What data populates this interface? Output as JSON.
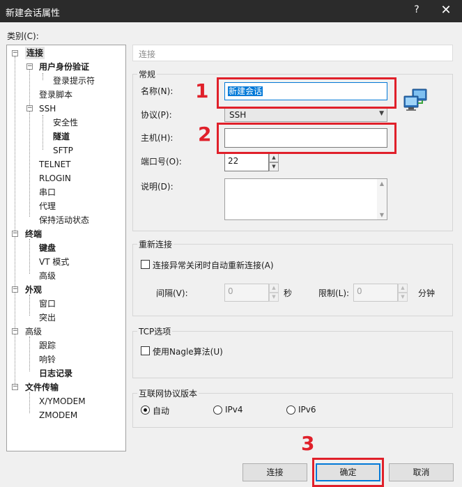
{
  "window": {
    "title": "新建会话属性",
    "help_glyph": "?",
    "close_glyph": "✕"
  },
  "category_label": "类别(C):",
  "tree": [
    {
      "label": "连接",
      "bold": true,
      "selected": true
    },
    {
      "label": "用户身份验证",
      "bold": true
    },
    {
      "label": "登录提示符"
    },
    {
      "label": "登录脚本"
    },
    {
      "label": "SSH"
    },
    {
      "label": "安全性"
    },
    {
      "label": "隧道",
      "bold": true
    },
    {
      "label": "SFTP"
    },
    {
      "label": "TELNET"
    },
    {
      "label": "RLOGIN"
    },
    {
      "label": "串口"
    },
    {
      "label": "代理"
    },
    {
      "label": "保持活动状态"
    },
    {
      "label": "终端",
      "bold": true
    },
    {
      "label": "键盘",
      "bold": true
    },
    {
      "label": "VT 模式"
    },
    {
      "label": "高级"
    },
    {
      "label": "外观",
      "bold": true
    },
    {
      "label": "窗口"
    },
    {
      "label": "突出"
    },
    {
      "label": "高级"
    },
    {
      "label": "跟踪"
    },
    {
      "label": "响铃"
    },
    {
      "label": "日志记录",
      "bold": true
    },
    {
      "label": "文件传输",
      "bold": true
    },
    {
      "label": "X/YMODEM"
    },
    {
      "label": "ZMODEM"
    }
  ],
  "header": "连接",
  "general": {
    "title": "常规",
    "name_label": "名称(N):",
    "name_value": "新建会话",
    "protocol_label": "协议(P):",
    "protocol_value": "SSH",
    "host_label": "主机(H):",
    "host_value": "",
    "port_label": "端口号(O):",
    "port_value": "22",
    "desc_label": "说明(D):"
  },
  "reconnect": {
    "title": "重新连接",
    "checkbox_label": "连接异常关闭时自动重新连接(A)",
    "interval_label": "间隔(V):",
    "interval_value": "0",
    "interval_unit": "秒",
    "limit_label": "限制(L):",
    "limit_value": "0",
    "limit_unit": "分钟"
  },
  "tcp": {
    "title": "TCP选项",
    "checkbox_label": "使用Nagle算法(U)"
  },
  "ipver": {
    "title": "互联网协议版本",
    "options": [
      "自动",
      "IPv4",
      "IPv6"
    ],
    "selected": 0
  },
  "buttons": {
    "connect": "连接",
    "ok": "确定",
    "cancel": "取消"
  },
  "annotations": [
    "1",
    "2",
    "3"
  ],
  "colors": {
    "annotation": "#e0202a",
    "selection": "#0078d7"
  }
}
